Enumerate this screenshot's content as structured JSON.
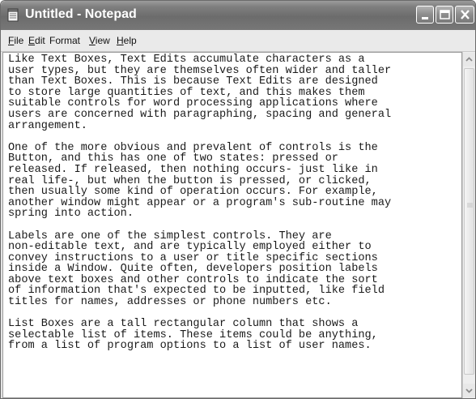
{
  "window": {
    "title": "Untitled - Notepad",
    "icon": "notepad-icon"
  },
  "controls": {
    "minimize_icon": "minimize-icon",
    "maximize_icon": "maximize-icon",
    "close_icon": "close-icon"
  },
  "menu": {
    "items": [
      {
        "underline": "F",
        "rest": "ile"
      },
      {
        "underline": "E",
        "rest": "dit"
      },
      {
        "underline": "",
        "rest": "Format"
      },
      {
        "underline": "V",
        "rest": "iew"
      },
      {
        "underline": "H",
        "rest": "elp"
      }
    ]
  },
  "editor": {
    "text": "Like Text Boxes, Text Edits accumulate characters as a\nuser types, but they are themselves often wider and taller\nthan Text Boxes. This is because Text Edits are designed\nto store large quantities of text, and this makes them\nsuitable controls for word processing applications where\nusers are concerned with paragraphing, spacing and general\narrangement.\n\nOne of the more obvious and prevalent of controls is the\nButton, and this has one of two states: pressed or\nreleased. If released, then nothing occurs- just like in\nreal life-, but when the button is pressed, or clicked,\nthen usually some kind of operation occurs. For example,\nanother window might appear or a program's sub-routine may\nspring into action.\n\nLabels are one of the simplest controls. They are\nnon-editable text, and are typically employed either to\nconvey instructions to a user or title specific sections\ninside a Window. Quite often, developers position labels\nabove text boxes and other controls to indicate the sort\nof information that's expected to be inputted, like field\ntitles for names, addresses or phone numbers etc.\n\nList Boxes are a tall rectangular column that shows a\nselectable list of items. These items could be anything,\nfrom a list of program options to a list of user names."
  },
  "scrollbar": {
    "up_icon": "scroll-up-arrow-icon",
    "down_icon": "scroll-down-arrow-icon",
    "grip_icon": "scroll-thumb-grip-icon"
  }
}
